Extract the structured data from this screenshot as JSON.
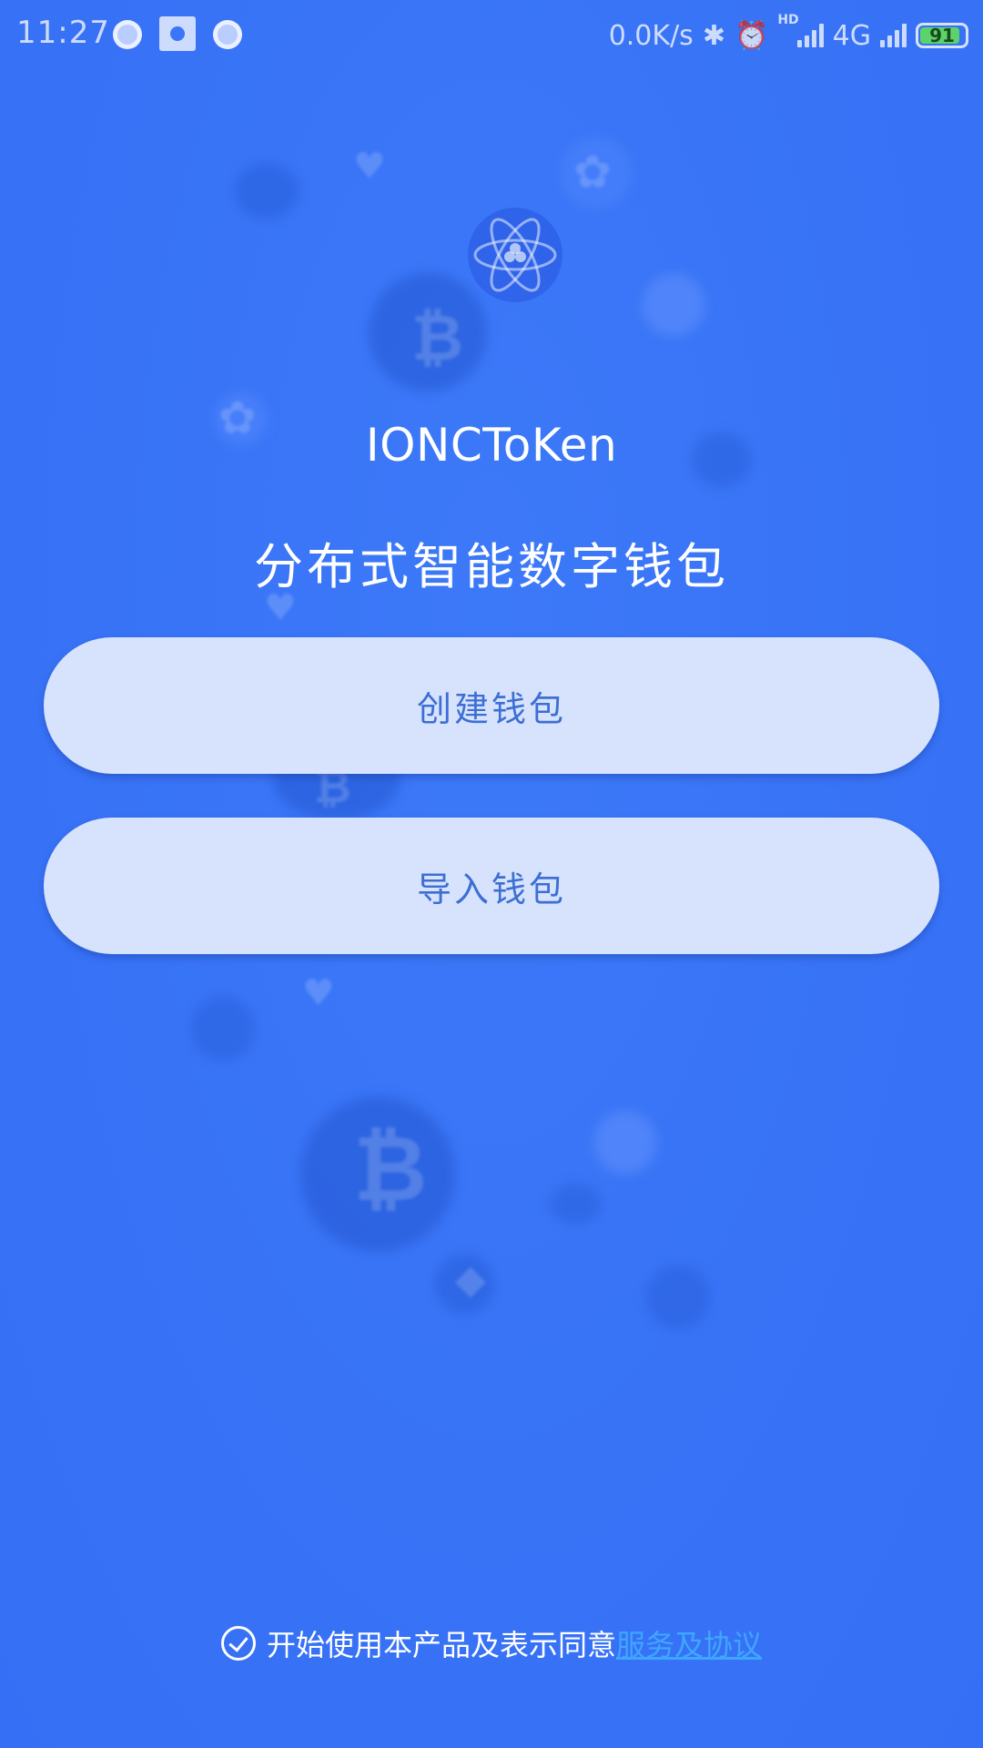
{
  "status_bar": {
    "time": "11:27",
    "net_speed": "0.0K/s",
    "hd": "HD",
    "network": "4G",
    "battery": "91",
    "battery_level": 0.91
  },
  "app": {
    "title": "IONCToKen",
    "subtitle": "分布式智能数字钱包"
  },
  "buttons": {
    "create": "创建钱包",
    "import": "导入钱包"
  },
  "agreement": {
    "text": "开始使用本产品及表示同意",
    "link": "服务及协议",
    "checked": true
  },
  "colors": {
    "background": "#3a76f7",
    "button_bg": "#d7e3fd",
    "button_text": "#3d6fd3",
    "link": "#3fa6ff",
    "battery": "#5bd36a"
  },
  "icons": {
    "logo": "atom-flower-icon",
    "bitcoin": "bitcoin-icon",
    "check": "check-circle-icon",
    "bluetooth": "bluetooth-icon",
    "alarm": "alarm-icon"
  }
}
